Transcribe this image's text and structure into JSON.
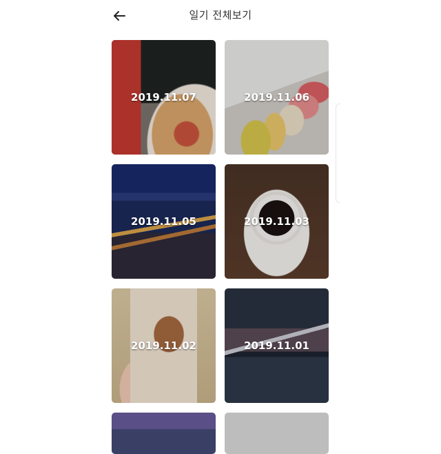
{
  "header": {
    "title": "일기 전체보기",
    "back_icon": "arrow-left-icon"
  },
  "diary_entries": [
    {
      "date": "2019.11.07",
      "photo": "coffee cup and donut"
    },
    {
      "date": "2019.11.06",
      "photo": "box of macarons"
    },
    {
      "date": "2019.11.05",
      "photo": "bridge and city at night"
    },
    {
      "date": "2019.11.03",
      "photo": "black coffee in cup"
    },
    {
      "date": "2019.11.02",
      "photo": "iced latte in hand"
    },
    {
      "date": "2019.11.01",
      "photo": "bridge over river at dusk"
    },
    {
      "date": "",
      "photo": "sky and mountains"
    },
    {
      "date": "",
      "photo": "gray placeholder"
    }
  ]
}
